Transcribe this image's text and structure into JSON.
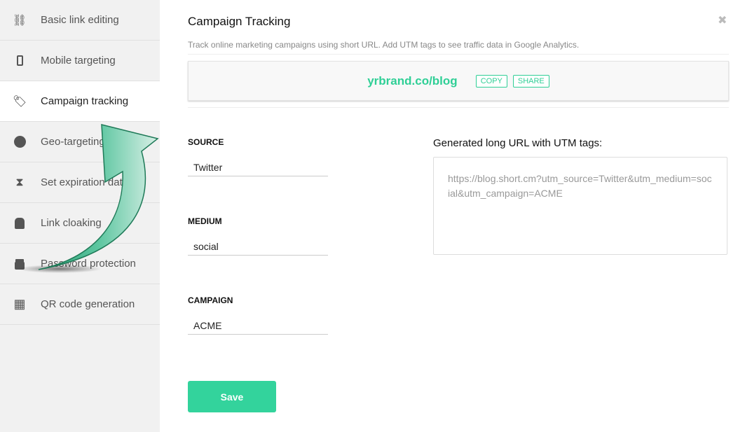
{
  "sidebar": {
    "items": [
      {
        "label": "Basic link editing",
        "icon": "link-icon"
      },
      {
        "label": "Mobile targeting",
        "icon": "mobile-icon"
      },
      {
        "label": "Campaign tracking",
        "icon": "tag-icon",
        "active": true
      },
      {
        "label": "Geo-targeting",
        "icon": "globe-icon"
      },
      {
        "label": "Set expiration date",
        "icon": "hourglass-icon"
      },
      {
        "label": "Link cloaking",
        "icon": "spy-icon"
      },
      {
        "label": "Password protection",
        "icon": "lock-icon"
      },
      {
        "label": "QR code generation",
        "icon": "qr-code-icon"
      }
    ]
  },
  "main": {
    "title": "Campaign Tracking",
    "description": "Track online marketing campaigns using short URL. Add UTM tags to see traffic data in Google Analytics.",
    "short_url": "yrbrand.co/blog",
    "copy_label": "COPY",
    "share_label": "SHARE",
    "fields": {
      "source": {
        "label": "SOURCE",
        "value": "Twitter"
      },
      "medium": {
        "label": "MEDIUM",
        "value": "social"
      },
      "campaign": {
        "label": "CAMPAIGN",
        "value": "ACME"
      }
    },
    "generated_label": "Generated long URL with UTM tags:",
    "generated_url": "https://blog.short.cm?utm_source=Twitter&utm_medium=social&utm_campaign=ACME",
    "save_label": "Save"
  },
  "colors": {
    "accent": "#33d39c",
    "sidebar_bg": "#f1f1f1"
  }
}
